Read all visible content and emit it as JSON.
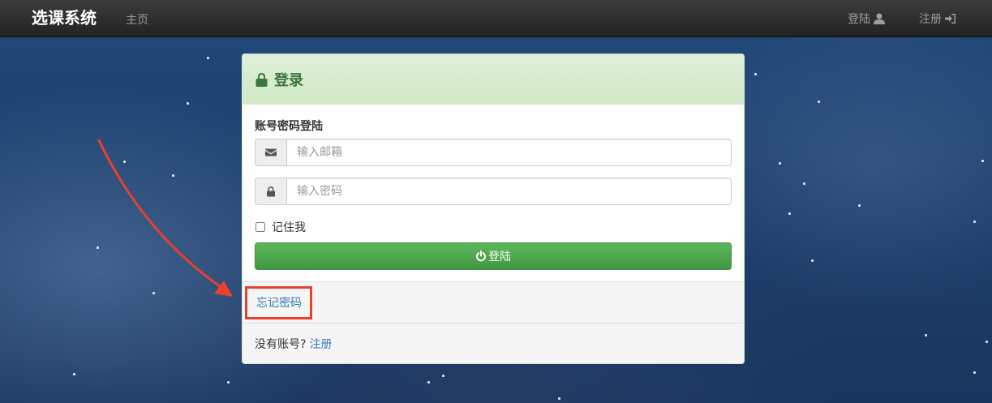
{
  "navbar": {
    "brand": "选课系统",
    "home": "主页",
    "login": "登陆",
    "register": "注册"
  },
  "panel": {
    "title": "登录",
    "section_label": "账号密码登陆",
    "email_placeholder": "输入邮箱",
    "password_placeholder": "输入密码",
    "remember_label": "记住我",
    "login_button": "登陆",
    "forgot_password": "忘记密码",
    "no_account_text": "没有账号?",
    "register_link": "注册"
  },
  "icons": {
    "panel_title": "lock-icon",
    "email": "envelope-icon",
    "password": "lock-icon",
    "login_button": "power-icon",
    "nav_login": "user-icon",
    "nav_register": "sign-in-icon"
  },
  "colors": {
    "navbar_bg": "#222222",
    "panel_heading_bg": "#dff0d8",
    "panel_heading_text": "#3c763d",
    "button_green": "#5cb85c",
    "link_blue": "#337ab7",
    "annotation_red": "#e8412c"
  }
}
